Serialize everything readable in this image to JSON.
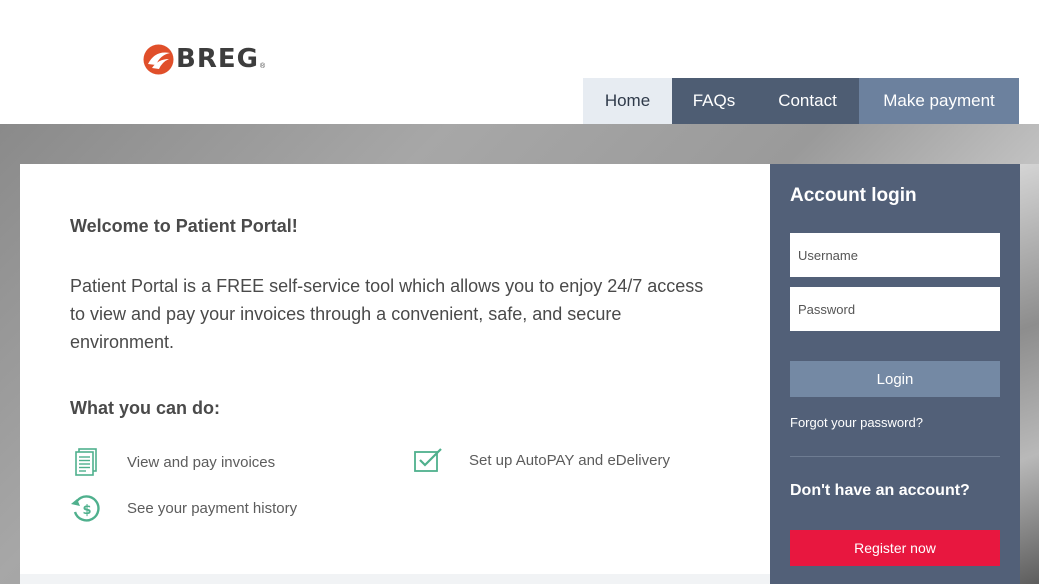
{
  "brand": {
    "name": "BREG",
    "trademark": "®",
    "accent": "#e04f2a"
  },
  "nav": {
    "home": "Home",
    "faqs": "FAQs",
    "contact": "Contact",
    "payment": "Make payment"
  },
  "main": {
    "welcome": "Welcome to Patient Portal!",
    "intro": "Patient Portal is a FREE self-service tool which allows you to enjoy 24/7 access to view and pay your invoices through a convenient, safe, and secure environment.",
    "cando_title": "What you can do:",
    "features": [
      {
        "icon": "document-list-icon",
        "label": "View and pay invoices"
      },
      {
        "icon": "checkbox-icon",
        "label": "Set up AutoPAY and eDelivery"
      },
      {
        "icon": "payment-history-icon",
        "label": "See your payment history"
      }
    ]
  },
  "login": {
    "title": "Account login",
    "username_placeholder": "Username",
    "password_placeholder": "Password",
    "login_label": "Login",
    "forgot_label": "Forgot your password?",
    "no_account": "Don't have an account?",
    "register_label": "Register now"
  },
  "colors": {
    "nav_dark": "#4e5d73",
    "nav_light": "#6c819e",
    "panel": "#526078",
    "register": "#e8173f",
    "icon_green": "#4fb08d"
  }
}
